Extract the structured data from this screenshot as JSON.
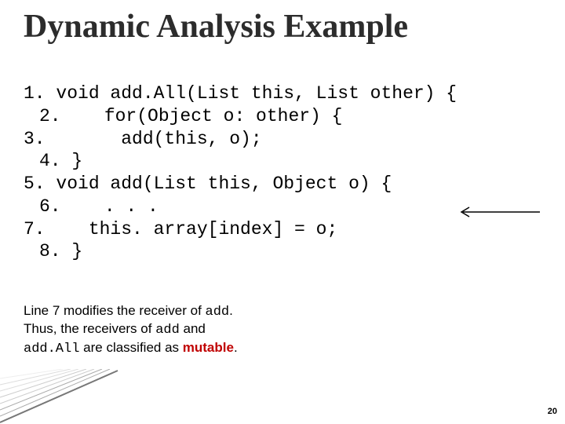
{
  "title": "Dynamic Analysis Example",
  "code": {
    "l1": "1. void add.All(List this, List other) {",
    "l2": "2.    for(Object o: other) {",
    "l3": "3.       add(this, o);",
    "l4": "4. }",
    "l5": "5. void add(List this, Object o) {",
    "l6": "6.    . . .",
    "l7": "7.    this. array[index] = o;",
    "l8": "8. }"
  },
  "explain": {
    "p1a": "Line 7 modifies the receiver of ",
    "p1b": "add",
    "p1c": ".",
    "p2a": "Thus, the receivers of ",
    "p2b": "add",
    "p2c": " and",
    "p3a": "add.All",
    "p3b": " are classified as ",
    "p3c": "mutable",
    "p3d": "."
  },
  "page_num": "20"
}
